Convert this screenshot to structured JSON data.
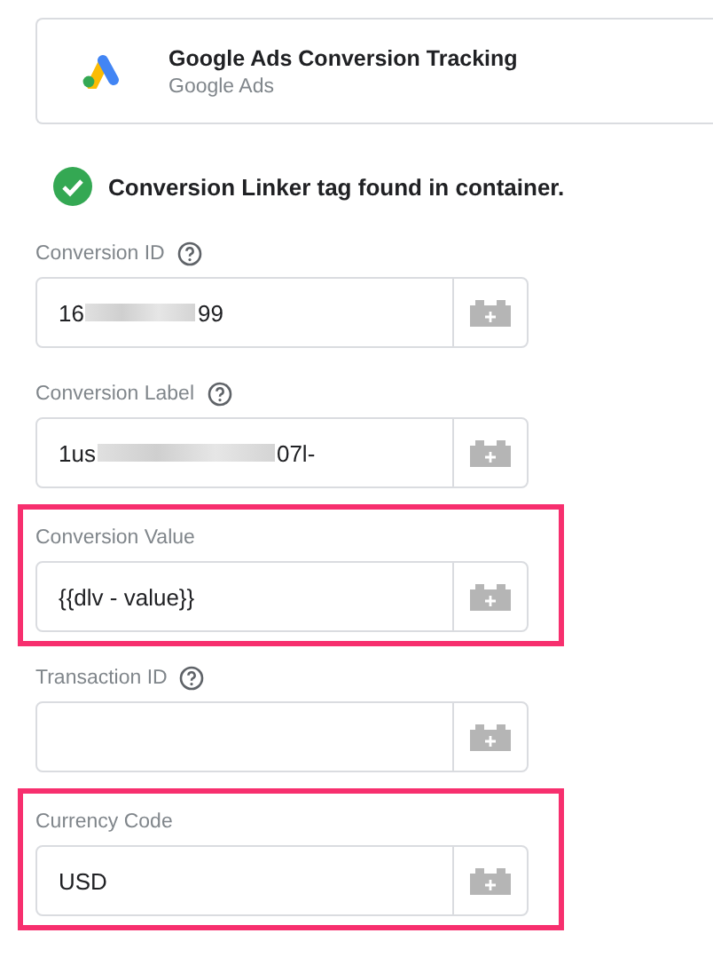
{
  "tag": {
    "title": "Google Ads Conversion Tracking",
    "subtitle": "Google Ads"
  },
  "notice": {
    "text": "Conversion Linker tag found in container."
  },
  "fields": [
    {
      "label": "Conversion ID",
      "help": true,
      "highlighted": false,
      "value_parts": [
        "16",
        "99"
      ]
    },
    {
      "label": "Conversion Label",
      "help": true,
      "highlighted": false,
      "value_parts": [
        "1us",
        "07l-"
      ]
    },
    {
      "label": "Conversion Value",
      "help": false,
      "highlighted": true,
      "value": "{{dlv - value}}"
    },
    {
      "label": "Transaction ID",
      "help": true,
      "highlighted": false
    },
    {
      "label": "Currency Code",
      "help": false,
      "highlighted": true,
      "value": "USD"
    }
  ]
}
